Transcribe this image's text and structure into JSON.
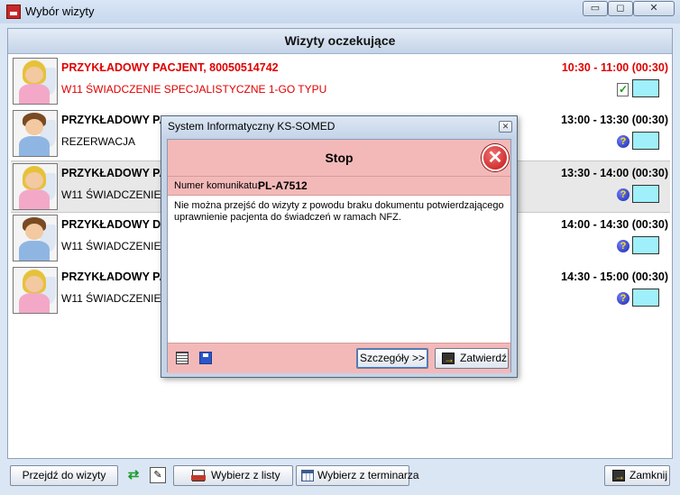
{
  "window": {
    "title": "Wybór wizyty",
    "controls": {
      "minimize": "▭",
      "maximize": "◻",
      "close": "✕"
    }
  },
  "panel": {
    "header": "Wizyty oczekujące"
  },
  "visits": [
    {
      "name": "PRZYKŁADOWY PACJENT, 80050514742",
      "service": "W11 ŚWIADCZENIE SPECJALISTYCZNE 1-GO TYPU",
      "time": "10:30 - 11:00 (00:30)",
      "highlight": "red",
      "gender": "female",
      "status_icon": "doc-check-icon",
      "color": "#9ff0fa"
    },
    {
      "name": "PRZYKŁADOWY PA",
      "service": "REZERWACJA",
      "time": "13:00 - 13:30 (00:30)",
      "highlight": "none",
      "gender": "male",
      "status_icon": "question-icon",
      "color": "#9ff0fa"
    },
    {
      "name": "PRZYKŁADOWY PA",
      "service": "W11 ŚWIADCZENIE S",
      "time": "13:30 - 14:00 (00:30)",
      "highlight": "selected",
      "gender": "female",
      "status_icon": "question-icon",
      "color": "#9ff0fa"
    },
    {
      "name": "PRZYKŁADOWY D",
      "service": "W11 ŚWIADCZENIE S",
      "time": "14:00 - 14:30 (00:30)",
      "highlight": "none",
      "gender": "male",
      "status_icon": "question-icon",
      "color": "#9ff0fa"
    },
    {
      "name": "PRZYKŁADOWY PA",
      "service": "W11 ŚWIADCZENIE S",
      "time": "14:30 - 15:00 (00:30)",
      "highlight": "none",
      "gender": "female",
      "status_icon": "question-icon",
      "color": "#9ff0fa"
    }
  ],
  "status_question_glyph": "?",
  "toolbar": {
    "go_to_visit": "Przejdź do wizyty",
    "choose_from_list": "Wybierz z listy",
    "choose_from_schedule": "Wybierz z terminarza",
    "close": "Zamknij",
    "refresh_glyph": "⇄",
    "note_glyph": "✎"
  },
  "dialog": {
    "title": "System Informatyczny KS-SOMED",
    "close_glyph": "✕",
    "heading": "Stop",
    "stop_glyph": "✕",
    "message_number_label": "Numer komunikatu:",
    "message_number": "PL-A7512",
    "message": "Nie można przejść do wizyty z powodu braku dokumentu potwierdzającego uprawnienie pacjenta do świadczeń w ramach NFZ.",
    "details_button": "Szczegóły >>",
    "confirm_button": "Zatwierdź"
  },
  "colors": {
    "accent_red": "#e00000",
    "dialog_bg": "#f3b9b9",
    "patient_color": "#9ff0fa"
  }
}
